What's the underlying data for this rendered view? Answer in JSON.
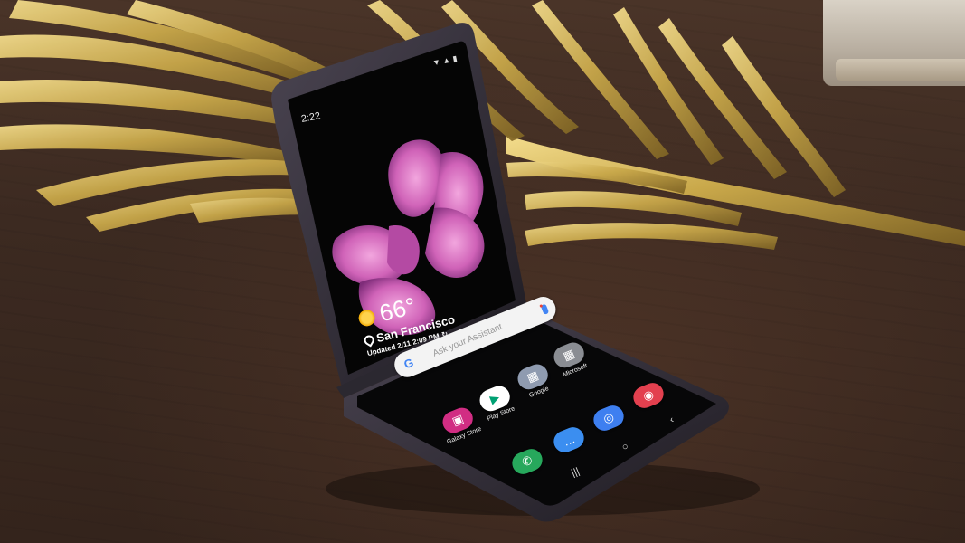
{
  "status_bar": {
    "time": "2:22",
    "icons": "▼ ▲ ▮"
  },
  "weather": {
    "temperature": "66°",
    "city": "San Francisco",
    "updated": "Updated 2/11 2:09 PM"
  },
  "search_bar": {
    "placeholder": "Ask your Assistant"
  },
  "apps": [
    {
      "label": "Microsoft",
      "icon": "microsoft-folder-icon",
      "color": "#8a8d93",
      "glyph": "▦"
    },
    {
      "label": "Google",
      "icon": "google-folder-icon",
      "color": "#8f9bb0",
      "glyph": "▦"
    },
    {
      "label": "Play Store",
      "icon": "play-store-icon",
      "color": "#ffffff",
      "glyph": "▶"
    },
    {
      "label": "Galaxy Store",
      "icon": "galaxy-store-icon",
      "color": "#d12d83",
      "glyph": "🛍"
    },
    {
      "label": "",
      "icon": "camera-icon",
      "color": "#e3404f",
      "glyph": "◉"
    },
    {
      "label": "",
      "icon": "internet-browser-icon",
      "color": "#3e7ff0",
      "glyph": "◎"
    },
    {
      "label": "",
      "icon": "messages-icon",
      "color": "#3b8ef0",
      "glyph": "…"
    },
    {
      "label": "",
      "icon": "phone-icon",
      "color": "#27a85c",
      "glyph": "✆"
    }
  ],
  "nav": {
    "recents": "|||",
    "home": "○",
    "back": "‹"
  },
  "colors": {
    "leaf_gold": "#c9a84a",
    "phone_body": "#2a2730",
    "table": "#3c2a21"
  }
}
